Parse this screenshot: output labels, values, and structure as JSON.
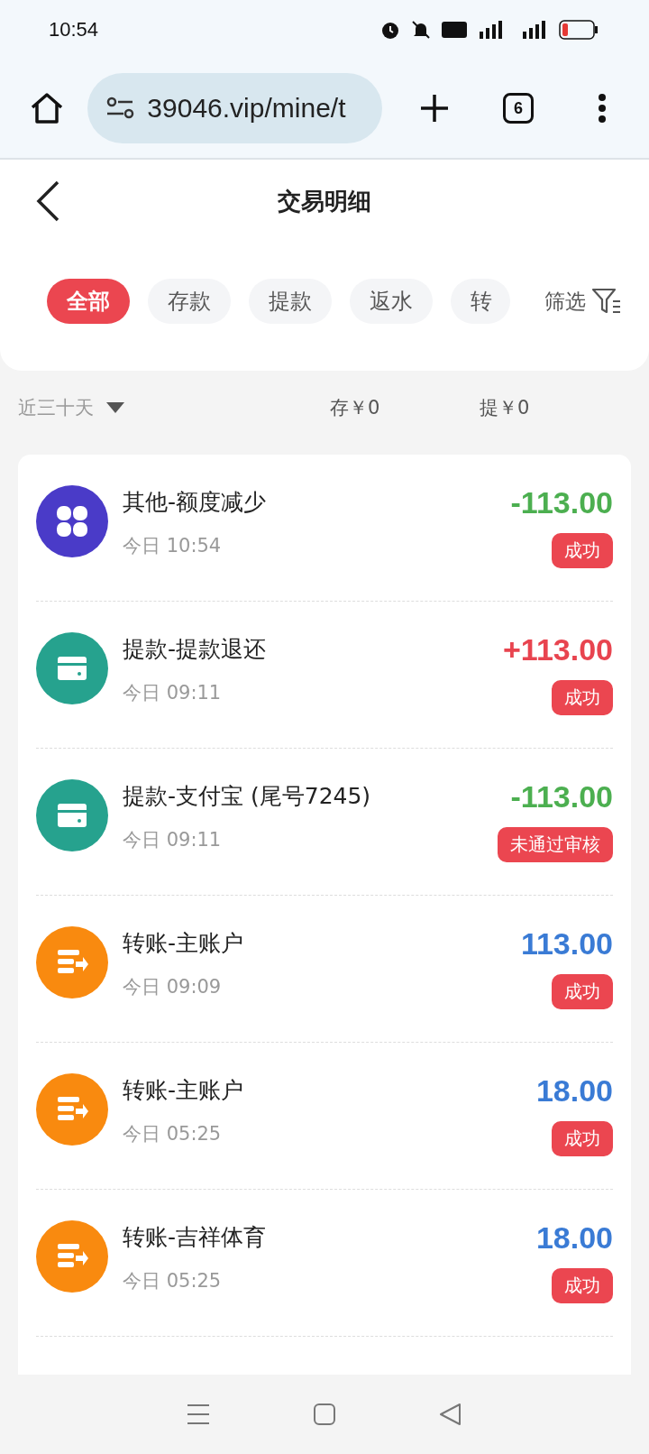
{
  "status_bar": {
    "time": "10:54"
  },
  "browser": {
    "url": "39046.vip/mine/t",
    "tab_count": "6"
  },
  "header": {
    "title": "交易明细"
  },
  "tabs": [
    {
      "label": "全部",
      "selected": true
    },
    {
      "label": "存款",
      "selected": false
    },
    {
      "label": "提款",
      "selected": false
    },
    {
      "label": "返水",
      "selected": false
    },
    {
      "label": "转",
      "selected": false
    }
  ],
  "filter": {
    "label": "筛选"
  },
  "summary": {
    "period": "近三十天",
    "deposit": "存￥0",
    "withdraw": "提￥0"
  },
  "transactions": [
    {
      "kind": "other",
      "title": "其他-额度减少",
      "time": "今日 10:54",
      "amount": "-113.00",
      "color": "#4caf50",
      "status": "成功"
    },
    {
      "kind": "withdraw",
      "title": "提款-提款退还",
      "time": "今日 09:11",
      "amount": "+113.00",
      "color": "#e8444f",
      "status": "成功"
    },
    {
      "kind": "withdraw",
      "title": "提款-支付宝 (尾号7245)",
      "time": "今日 09:11",
      "amount": "-113.00",
      "color": "#4caf50",
      "status": "未通过审核"
    },
    {
      "kind": "transfer",
      "title": "转账-主账户",
      "time": "今日 09:09",
      "amount": "113.00",
      "color": "#3a7bd5",
      "status": "成功"
    },
    {
      "kind": "transfer",
      "title": "转账-主账户",
      "time": "今日 05:25",
      "amount": "18.00",
      "color": "#3a7bd5",
      "status": "成功"
    },
    {
      "kind": "transfer",
      "title": "转账-吉祥体育",
      "time": "今日 05:25",
      "amount": "18.00",
      "color": "#3a7bd5",
      "status": "成功"
    }
  ]
}
